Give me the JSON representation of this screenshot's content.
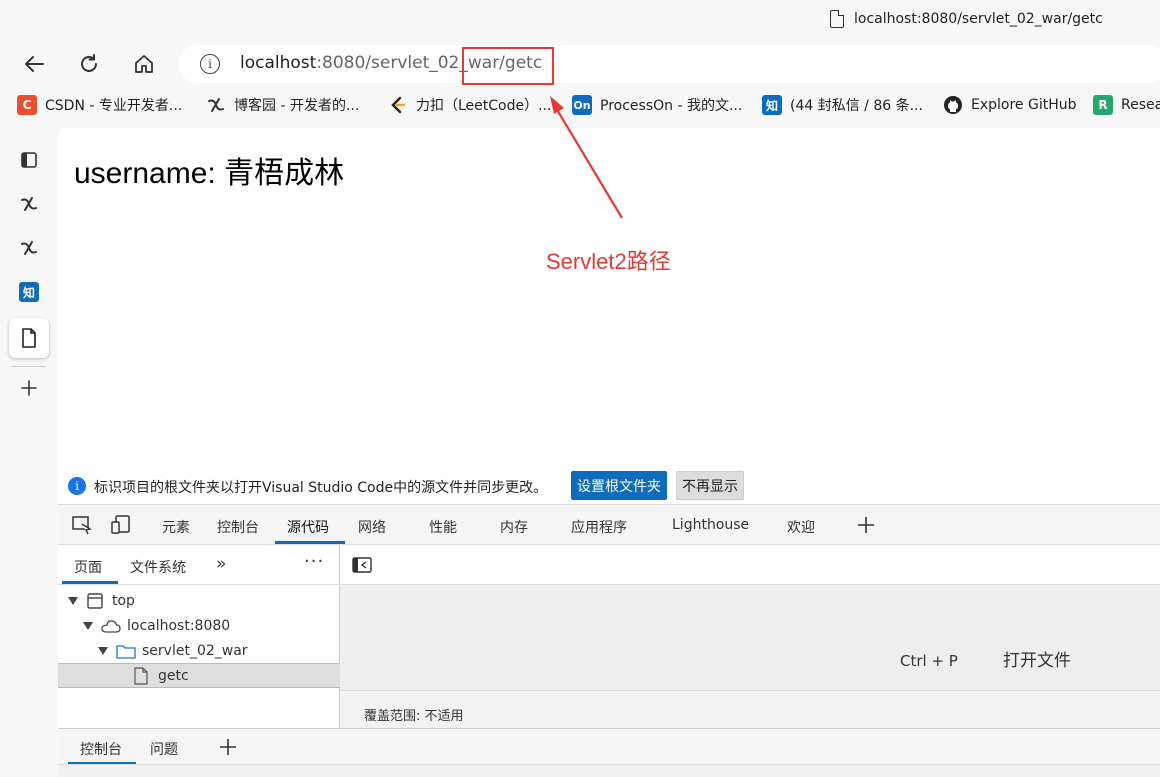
{
  "tooltip": {
    "text": "localhost:8080/servlet_02_war/getc"
  },
  "address_bar": {
    "host": "localhost",
    "rest": ":8080/servlet_02_war/getc"
  },
  "bookmarks": [
    {
      "label": "CSDN - 专业开发者...",
      "icon": "C",
      "color": "#e94e31"
    },
    {
      "label": "博客园 - 开发者的...",
      "icon": "cnblogs-icon"
    },
    {
      "label": "力扣（LeetCode）...",
      "icon": "leetcode-icon"
    },
    {
      "label": "ProcessOn - 我的文...",
      "icon": "On",
      "color": "#0f6cbd"
    },
    {
      "label": "(44 封私信 / 86 条...",
      "icon": "知",
      "color": "#0f6cbd"
    },
    {
      "label": "Explore GitHub",
      "icon": "github-icon"
    },
    {
      "label": "Resea",
      "icon": "R",
      "color": "#27a56f"
    }
  ],
  "page": {
    "content": "username: 青梧成林"
  },
  "annotation": {
    "text": "Servlet2路径"
  },
  "devtools": {
    "notice": {
      "text": "标识项目的根文件夹以打开Visual Studio Code中的源文件并同步更改。",
      "primary": "设置根文件夹",
      "secondary": "不再显示"
    },
    "tabs": [
      "元素",
      "控制台",
      "源代码",
      "网络",
      "性能",
      "内存",
      "应用程序",
      "Lighthouse",
      "欢迎"
    ],
    "left_tabs": [
      "页面",
      "文件系统"
    ],
    "tree": [
      "top",
      "localhost:8080",
      "servlet_02_war",
      "getc"
    ],
    "shortcut": "Ctrl + P",
    "open_file": "打开文件",
    "coverage": "覆盖范围: 不适用",
    "console_tabs": [
      "控制台",
      "问题"
    ]
  }
}
